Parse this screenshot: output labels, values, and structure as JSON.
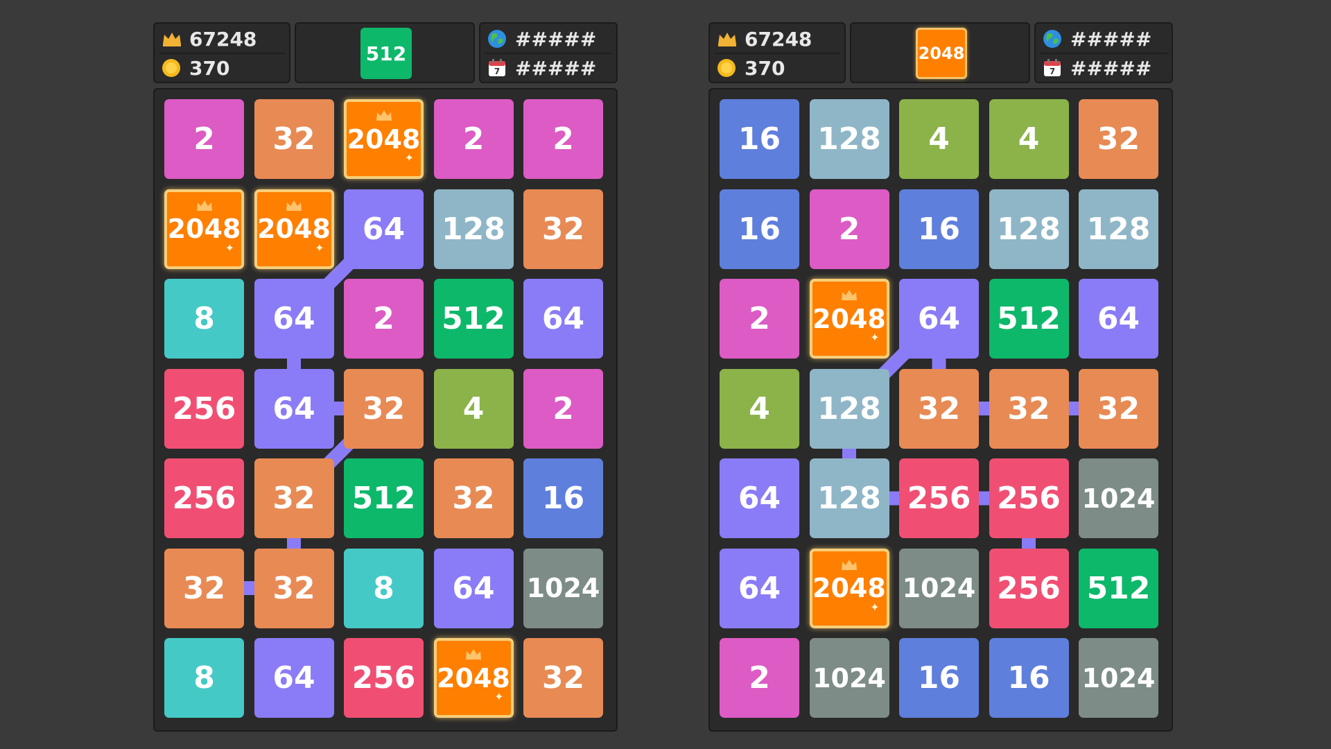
{
  "colors": {
    "background": "#3a3a3a",
    "panel": "#2a2a2a",
    "tiles": {
      "2": "#dd5bc4",
      "4": "#8bb34a",
      "8": "#45c9c6",
      "16": "#5f7fdc",
      "32": "#e88a54",
      "64": "#8a7cf6",
      "128": "#8fb6c7",
      "256": "#f04f73",
      "512": "#0db86a",
      "1024": "#7d8c86",
      "2048": "#ff7f00"
    }
  },
  "panels": [
    {
      "id": "left",
      "hud": {
        "best_score": "67248",
        "coins": "370",
        "global_rank": "#####",
        "daily_rank": "#####",
        "target_value": "512"
      },
      "grid": [
        [
          "2",
          "32",
          "2048",
          "2",
          "2"
        ],
        [
          "2048",
          "2048",
          "64",
          "128",
          "32"
        ],
        [
          "8",
          "64",
          "2",
          "512",
          "64"
        ],
        [
          "256",
          "64",
          "32",
          "4",
          "2"
        ],
        [
          "256",
          "32",
          "512",
          "32",
          "16"
        ],
        [
          "32",
          "32",
          "8",
          "64",
          "1024"
        ],
        [
          "8",
          "64",
          "256",
          "2048",
          "32"
        ]
      ],
      "chain": [
        [
          1,
          2
        ],
        [
          2,
          1
        ],
        [
          3,
          1
        ],
        [
          3,
          2
        ],
        [
          4,
          1
        ],
        [
          5,
          1
        ],
        [
          5,
          0
        ]
      ]
    },
    {
      "id": "right",
      "hud": {
        "best_score": "67248",
        "coins": "370",
        "global_rank": "#####",
        "daily_rank": "#####",
        "target_value": "2048"
      },
      "grid": [
        [
          "16",
          "128",
          "4",
          "4",
          "32"
        ],
        [
          "16",
          "2",
          "16",
          "128",
          "128"
        ],
        [
          "2",
          "2048",
          "64",
          "512",
          "64"
        ],
        [
          "4",
          "128",
          "32",
          "32",
          "32"
        ],
        [
          "64",
          "128",
          "256",
          "256",
          "1024"
        ],
        [
          "64",
          "2048",
          "1024",
          "256",
          "512"
        ],
        [
          "2",
          "1024",
          "16",
          "16",
          "1024"
        ]
      ],
      "chain": [
        [
          2,
          2
        ],
        [
          3,
          2
        ],
        [
          3,
          3
        ],
        [
          3,
          4
        ]
      ],
      "chain2": [
        [
          2,
          2
        ],
        [
          3,
          1
        ],
        [
          4,
          1
        ],
        [
          4,
          2
        ],
        [
          4,
          3
        ],
        [
          5,
          3
        ]
      ]
    }
  ]
}
